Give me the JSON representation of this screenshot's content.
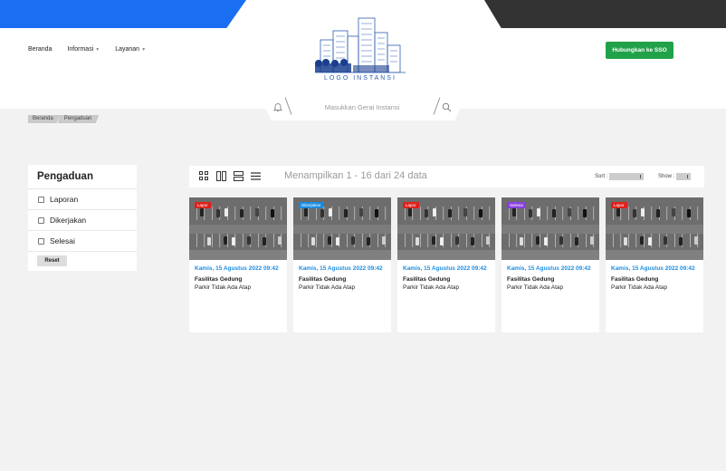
{
  "header": {
    "nav": [
      {
        "label": "Beranda",
        "has_dropdown": false
      },
      {
        "label": "Informasi",
        "has_dropdown": true
      },
      {
        "label": "Layanan",
        "has_dropdown": true
      }
    ],
    "logo_text": "LOGO INSTANSI",
    "sso_label": "Hubungkan ke SSO",
    "search_placeholder": "Masukkan Gerai Instansi",
    "colors": {
      "accent_blue": "#1a6ef2",
      "dark": "#333333",
      "sso_green": "#21a24a"
    }
  },
  "breadcrumb": [
    "Beranda",
    "Pengaduan"
  ],
  "filter": {
    "title": "Pengaduan",
    "options": [
      "Laporan",
      "Dikerjakan",
      "Selesai"
    ],
    "reset_label": "Reset"
  },
  "toolbar": {
    "count_text": "Menampilkan 1 - 16 dari 24 data",
    "sort_label": "Sort :",
    "show_label": "Show :",
    "view_icons": [
      "grid-view-icon",
      "two-column-view-icon",
      "row-view-icon",
      "list-view-icon"
    ]
  },
  "cards": [
    {
      "status": "Lapor",
      "status_color": "#e0201a",
      "date": "Kamis, 15 Agustus 2022 09:42",
      "category": "Fasilitas Gedung",
      "title": "Parkir Tidak Ada Atap"
    },
    {
      "status": "Dikerjakan",
      "status_color": "#1a8ce0",
      "date": "Kamis, 15 Agustus 2022 09:42",
      "category": "Fasilitas Gedung",
      "title": "Parkir Tidak Ada Atap"
    },
    {
      "status": "Lapor",
      "status_color": "#e0201a",
      "date": "Kamis, 15 Agustus 2022 09:42",
      "category": "Fasilitas Gedung",
      "title": "Parkir Tidak Ada Atap"
    },
    {
      "status": "Selesai",
      "status_color": "#8a3fe0",
      "date": "Kamis, 15 Agustus 2022 09:42",
      "category": "Fasilitas Gedung",
      "title": "Parkir Tidak Ada Atap"
    },
    {
      "status": "Lapor",
      "status_color": "#e0201a",
      "date": "Kamis, 15 Agustus 2022 09:42",
      "category": "Fasilitas Gedung",
      "title": "Parkir Tidak Ada Atap"
    }
  ]
}
